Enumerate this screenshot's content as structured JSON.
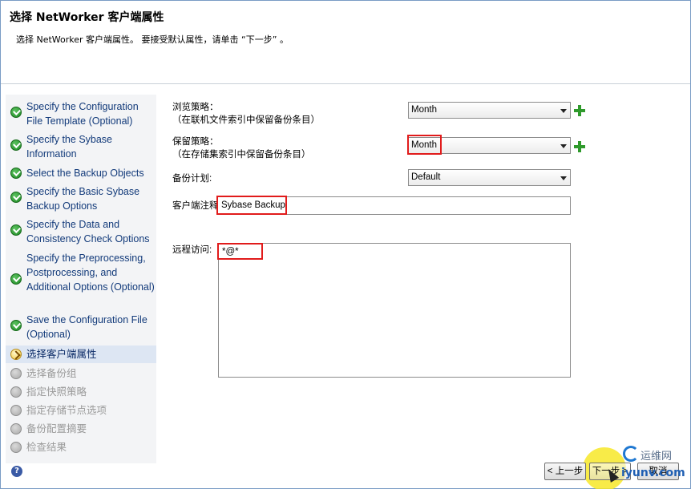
{
  "header": {
    "title": "选择 NetWorker 客户端属性",
    "subtitle": "选择 NetWorker 客户端属性。 要接受默认属性，请单击 “下一步” 。"
  },
  "steps": [
    {
      "label": "Specify the Configuration File Template (Optional)",
      "status": "done"
    },
    {
      "label": "Specify the Sybase Information",
      "status": "done"
    },
    {
      "label": "Select the Backup Objects",
      "status": "done"
    },
    {
      "label": "Specify the Basic Sybase Backup Options",
      "status": "done"
    },
    {
      "label": "Specify the Data and Consistency Check Options",
      "status": "done"
    },
    {
      "label": "Specify the Preprocessing, Postprocessing, and Additional Options (Optional)",
      "status": "done"
    },
    {
      "label": "Save the Configuration File (Optional)",
      "status": "done"
    },
    {
      "label": "选择客户端属性",
      "status": "current"
    },
    {
      "label": "选择备份组",
      "status": "pending"
    },
    {
      "label": "指定快照策略",
      "status": "pending"
    },
    {
      "label": "指定存储节点选项",
      "status": "pending"
    },
    {
      "label": "备份配置摘要",
      "status": "pending"
    },
    {
      "label": "检查结果",
      "status": "pending"
    }
  ],
  "form": {
    "browse_policy": {
      "label": "浏览策略：",
      "note": "（在联机文件索引中保留备份条目）",
      "value": "Month"
    },
    "retention_policy": {
      "label": "保留策略：",
      "note": "（在存储集索引中保留备份条目）",
      "value": "Month"
    },
    "schedule": {
      "label": "备份计划:",
      "value": "Default"
    },
    "client_comment": {
      "label": "客户端注释",
      "value": "Sybase Backup"
    },
    "remote_access": {
      "label": "远程访问:",
      "value": "*@*"
    }
  },
  "buttons": {
    "back": "< 上一步",
    "next": "下一步 >",
    "cancel": "取消"
  },
  "help_icon_glyph": "?",
  "watermark": {
    "top": "运维网",
    "bottom": "iyunv.com"
  }
}
